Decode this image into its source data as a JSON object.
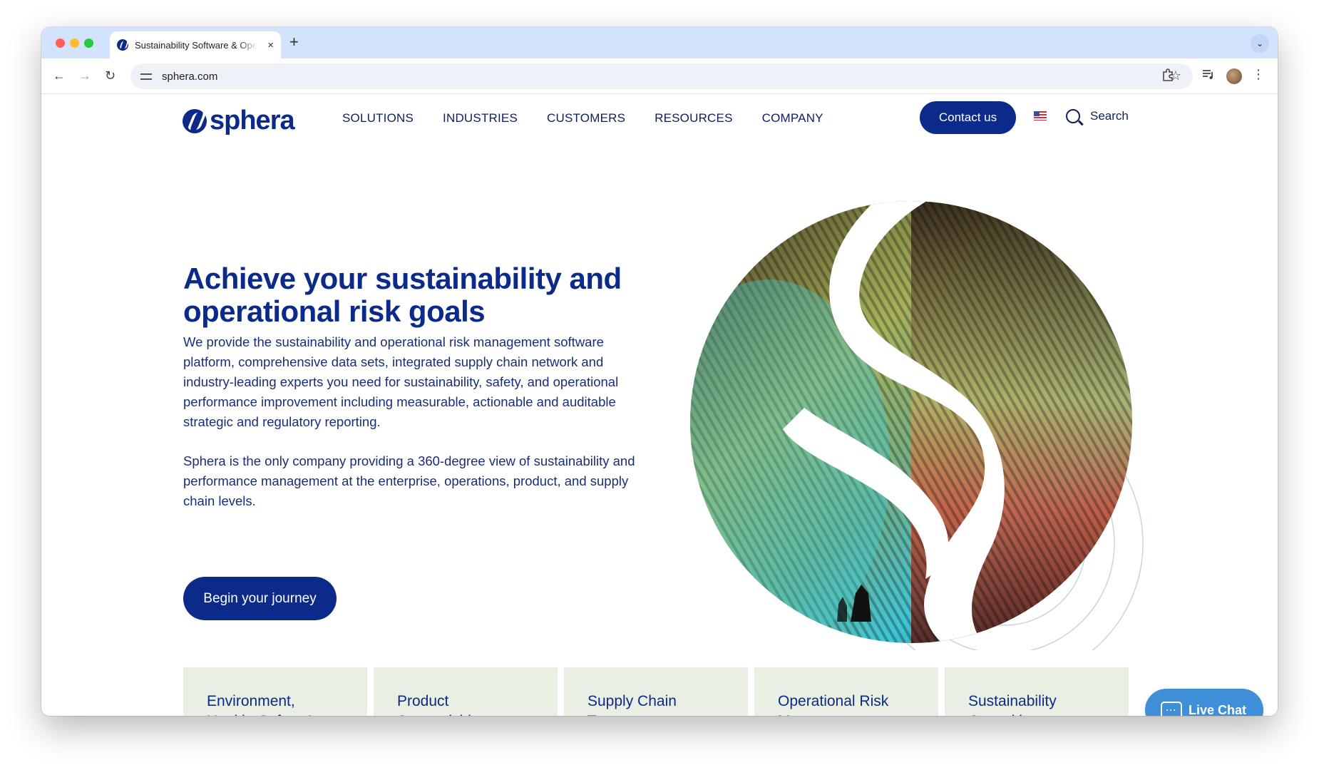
{
  "browser": {
    "tab_title": "Sustainability Software & Operational Risk",
    "tab_close": "×",
    "new_tab": "+",
    "url": "sphera.com",
    "back": "←",
    "forward": "→",
    "reload": "↻",
    "star": "☆",
    "menu": "⋮",
    "tab_dropdown": "⌄"
  },
  "header": {
    "logo_text": "sphera",
    "nav": [
      "SOLUTIONS",
      "INDUSTRIES",
      "CUSTOMERS",
      "RESOURCES",
      "COMPANY"
    ],
    "contact_label": "Contact us",
    "search_label": "Search"
  },
  "hero": {
    "headline": "Achieve your sustainability and operational risk goals",
    "paragraph1": "We provide the sustainability and operational risk management software platform, comprehensive data sets, integrated supply chain network and industry-leading experts you need for sustainability, safety, and operational performance improvement including measurable, actionable and auditable strategic and regulatory reporting.",
    "paragraph2": "Sphera is the only company providing a 360-degree view of sustainability and performance management at the enterprise, operations, product, and supply chain levels.",
    "cta_label": "Begin your journey"
  },
  "cards": [
    {
      "label": "Environment, Health, Safety & Sustainability"
    },
    {
      "label": "Product Stewardship"
    },
    {
      "label": "Supply Chain Transparency"
    },
    {
      "label": "Operational Risk Management"
    },
    {
      "label": "Sustainability Consulting"
    }
  ],
  "live_chat": {
    "label": "Live Chat"
  },
  "colors": {
    "brand": "#0b2a8a",
    "card_bg": "#e9efe3",
    "chat": "#3f8ed8"
  }
}
